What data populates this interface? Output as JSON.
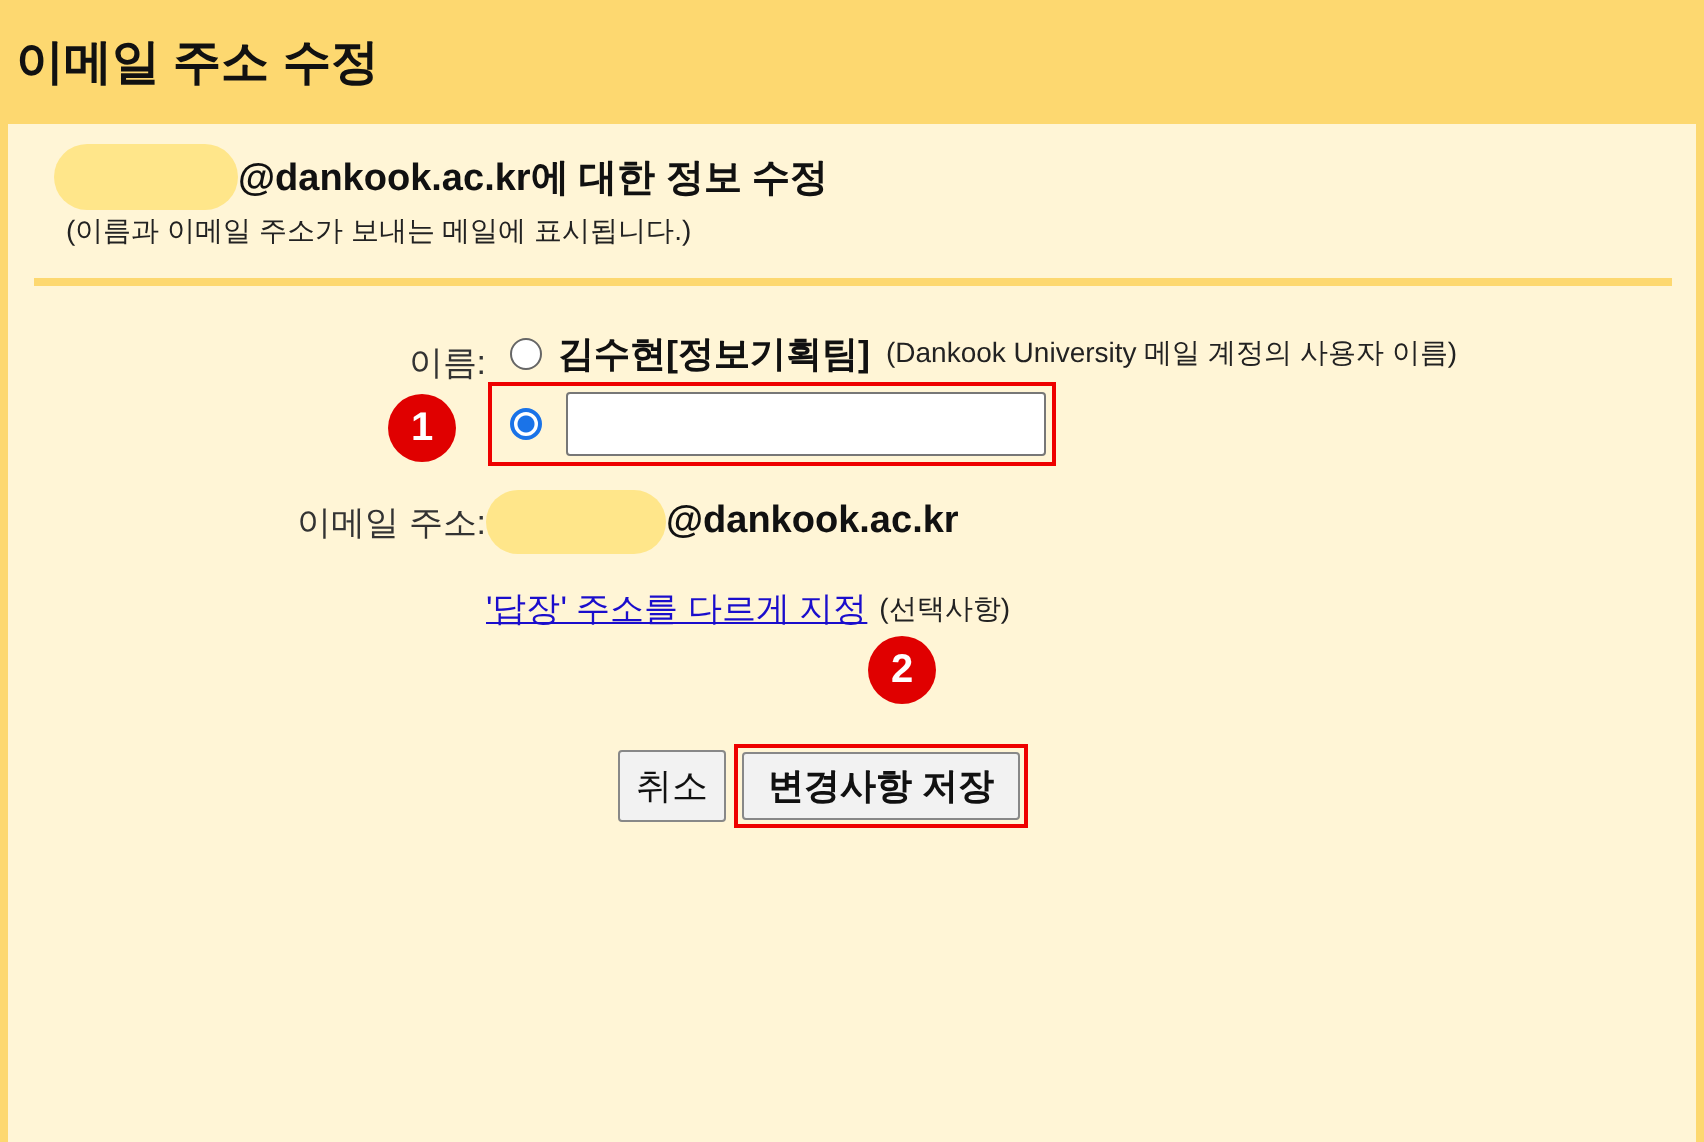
{
  "title": "이메일 주소 수정",
  "header": {
    "heading": "@dankook.ac.kr에 대한 정보 수정",
    "note": "(이름과 이메일 주소가 보내는 메일에 표시됩니다.)"
  },
  "name_field": {
    "label": "이름:",
    "options": [
      {
        "kind": "preset",
        "name": "김수현[정보기획팀]",
        "note": "(Dankook University 메일 계정의 사용자 이름)",
        "selected": false
      },
      {
        "kind": "custom",
        "selected": true,
        "callout": "1"
      }
    ]
  },
  "email": {
    "label": "이메일 주소:",
    "domain": "@dankook.ac.kr"
  },
  "reply_link": {
    "text": "'답장' 주소를 다르게 지정",
    "note": "(선택사항)"
  },
  "buttons": [
    {
      "label": "취소"
    },
    {
      "label": "변경사항 저장",
      "callout": "2"
    }
  ]
}
